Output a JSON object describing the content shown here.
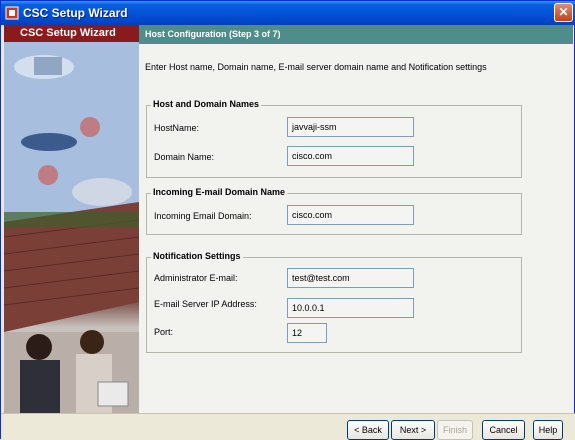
{
  "window": {
    "title": "CSC Setup Wizard"
  },
  "sidebar": {
    "title": "CSC Setup Wizard"
  },
  "header": {
    "step_title": "Host Configuration  (Step 3 of 7)"
  },
  "intro": "Enter Host name, Domain name, E-mail server domain name and Notification settings",
  "host_domain": {
    "title": "Host and Domain Names",
    "hostname_label": "HostName:",
    "hostname_value": "javvaji-ssm",
    "domain_label": "Domain Name:",
    "domain_value": "cisco.com"
  },
  "incoming": {
    "title": "Incoming E-mail Domain Name",
    "domain_label": "Incoming Email Domain:",
    "domain_value": "cisco.com"
  },
  "notification": {
    "title": "Notification Settings",
    "admin_label": "Administrator E-mail:",
    "admin_value": "test@test.com",
    "server_label": "E-mail Server IP Address:",
    "server_value": "10.0.0.1",
    "port_label": "Port:",
    "port_value": "12"
  },
  "buttons": {
    "back": "< Back",
    "next": "Next >",
    "finish": "Finish",
    "cancel": "Cancel",
    "help": "Help"
  }
}
